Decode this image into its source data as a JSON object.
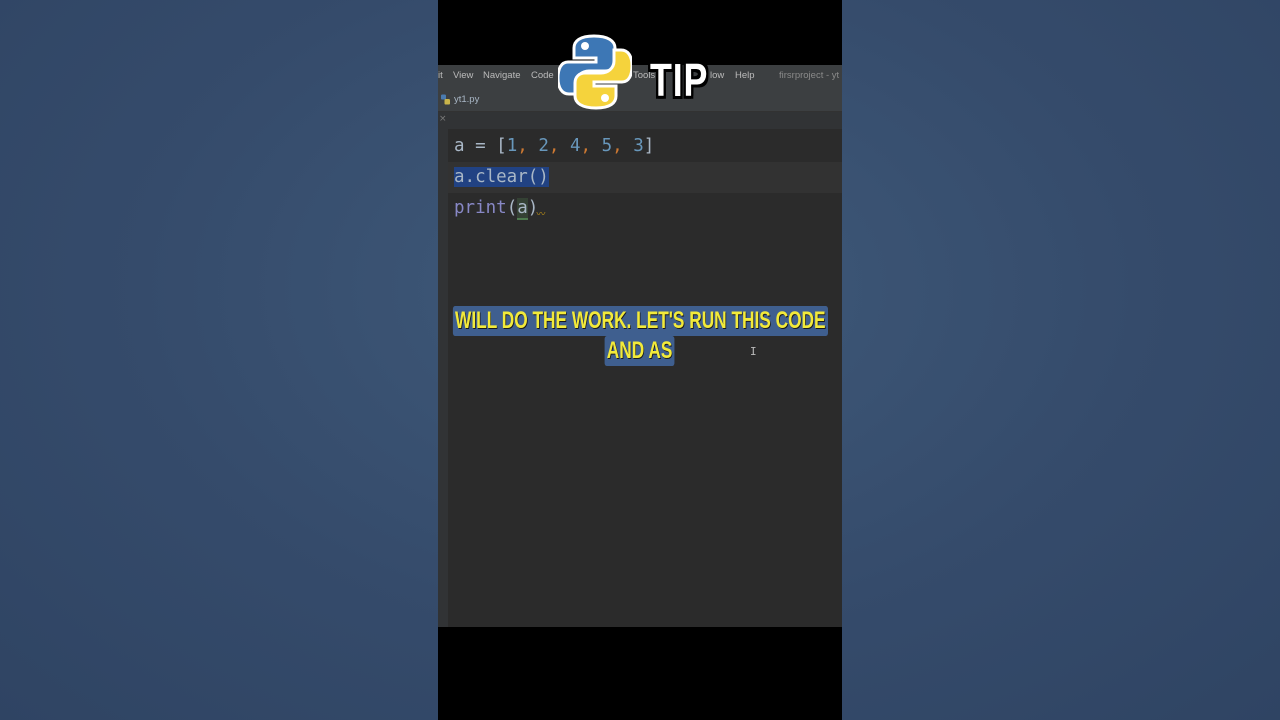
{
  "menu": {
    "items": [
      "it",
      "View",
      "Navigate",
      "Code",
      "Tools",
      "low",
      "Help"
    ],
    "project_title": "firsrproject - yt"
  },
  "tab": {
    "file_name": "yt1.py",
    "icon": "python-file-icon"
  },
  "code_lines": [
    {
      "assign_var": "a",
      "op": " = ",
      "open": "[",
      "n1": "1",
      "n2": "2",
      "n3": "4",
      "n4": "5",
      "n5": "3",
      "close": "]"
    },
    {
      "text": "a.clear()"
    },
    {
      "fn": "print",
      "open": "(",
      "arg": "a",
      "close": ")"
    }
  ],
  "overlay": {
    "logo": "python-logo",
    "tip_label": "TIP",
    "caption_line1": "Will do the work. Let's run this code",
    "caption_line2": "and as"
  },
  "colors": {
    "background": "#3a5475",
    "editor_bg": "#2b2b2b",
    "selection": "#214283",
    "number": "#6897bb",
    "comma": "#cc7832",
    "caption_text": "#f2ea3a",
    "caption_bg": "#3f5f8f"
  }
}
